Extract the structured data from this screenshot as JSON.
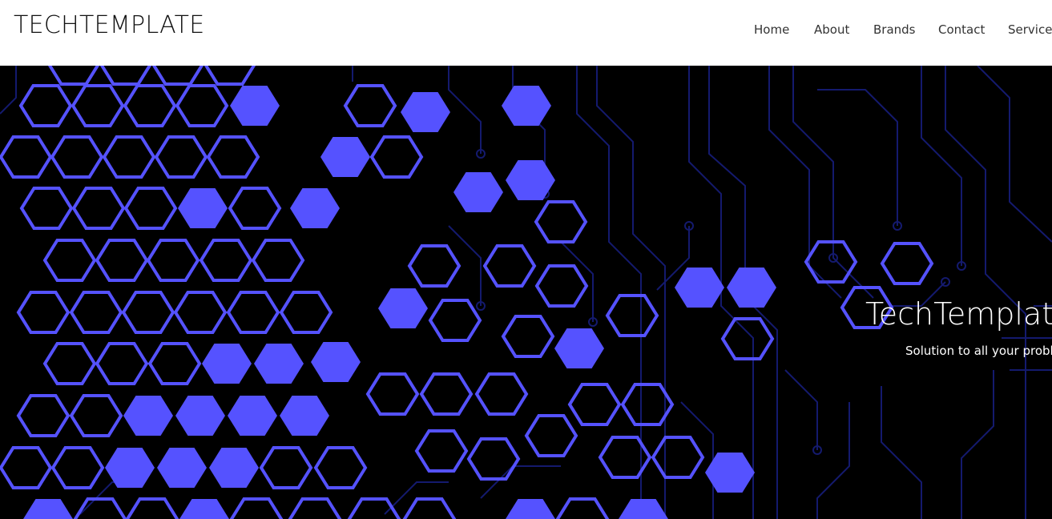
{
  "header": {
    "brand": "TECHTEMPLATE",
    "nav": [
      {
        "label": "Home"
      },
      {
        "label": "About"
      },
      {
        "label": "Brands"
      },
      {
        "label": "Contact"
      },
      {
        "label": "Services"
      }
    ]
  },
  "hero": {
    "title": "TechTemplate",
    "subtitle": "Solution to all your problems"
  },
  "colors": {
    "accent": "#5552ff",
    "circuit": "#141a6e",
    "background": "#000000",
    "header_bg": "#ffffff"
  }
}
